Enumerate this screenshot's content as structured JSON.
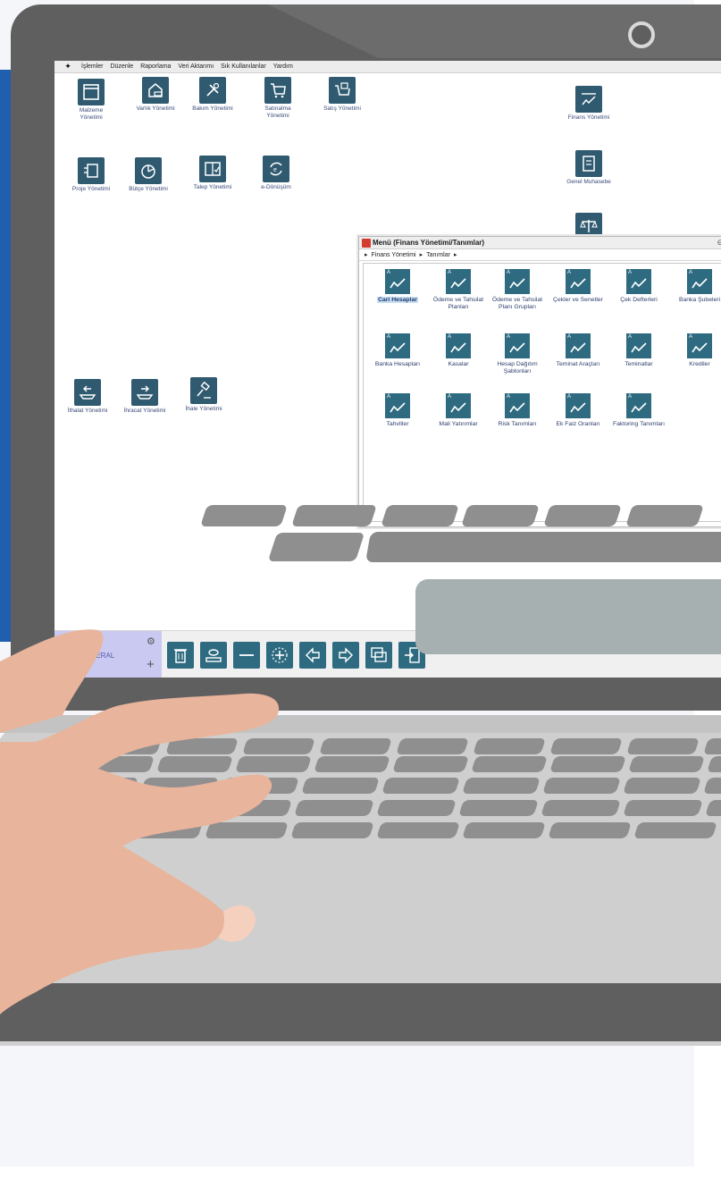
{
  "menubar": {
    "items": [
      "İşlemler",
      "Düzenle",
      "Raporlama",
      "Veri Aktarımı",
      "Sık Kullanılanlar",
      "Yardım"
    ]
  },
  "desktop": {
    "icons": [
      {
        "label": "Malzeme Yönetimi",
        "icon": "window-icon"
      },
      {
        "label": "Varlık Yönetimi",
        "icon": "house-car-icon"
      },
      {
        "label": "Bakım Yönetimi",
        "icon": "tools-icon"
      },
      {
        "label": "Satınalma Yönetimi",
        "icon": "cart-icon"
      },
      {
        "label": "Satış Yönetimi",
        "icon": "cart-box-icon"
      },
      {
        "label": "Finans Yönetimi",
        "icon": "chart-line-icon"
      },
      {
        "label": "Proje Yönetimi",
        "icon": "project-icon"
      },
      {
        "label": "Bütçe Yönetimi",
        "icon": "pie-chart-icon"
      },
      {
        "label": "Talep Yönetimi",
        "icon": "checklist-icon"
      },
      {
        "label": "e-Dönüşüm",
        "icon": "e-transform-icon"
      },
      {
        "label": "Genel Muhasebe",
        "icon": "ledger-icon"
      },
      {
        "label": "",
        "icon": "scale-icon"
      },
      {
        "label": "İthalat Yönetimi",
        "icon": "import-ship-icon"
      },
      {
        "label": "İhracat Yönetimi",
        "icon": "export-ship-icon"
      },
      {
        "label": "İhale Yönetimi",
        "icon": "gavel-icon"
      }
    ]
  },
  "window": {
    "title": "Menü (Finans Yönetimi/Tanımlar)",
    "breadcrumb": [
      "Finans Yönetimi",
      "Tanımlar"
    ],
    "items": [
      {
        "label": "Cari Hesaplar",
        "selected": true
      },
      {
        "label": "Ödeme ve Tahsilat Planları"
      },
      {
        "label": "Ödeme ve Tahsilat Planı Grupları"
      },
      {
        "label": "Çekler ve Senetler"
      },
      {
        "label": "Çek Defterleri"
      },
      {
        "label": "Banka Şubeleri"
      },
      {
        "label": "Banka Hesapları"
      },
      {
        "label": "Kasalar"
      },
      {
        "label": "Hesap Dağıtım Şablonları"
      },
      {
        "label": "Teminat Araçları"
      },
      {
        "label": "Teminatlar"
      },
      {
        "label": "Krediler"
      },
      {
        "label": "Tahviller"
      },
      {
        "label": "Mali Yatırımlar"
      },
      {
        "label": "Risk Tanımları"
      },
      {
        "label": "Ek Faiz Oranları"
      },
      {
        "label": "Faktoring Tanımları"
      }
    ]
  },
  "toolbar": {
    "profile_label": "GENERAL",
    "buttons": [
      "trash-icon",
      "preview-icon",
      "minus-icon",
      "add-icon",
      "back-icon",
      "forward-icon",
      "windows-icon",
      "exit-icon"
    ]
  },
  "colors": {
    "accent_blue": "#1f5fae",
    "tile": "#2e6b80",
    "laptop_gray": "#5f5f60",
    "profile_bg": "#c9c9f2"
  }
}
